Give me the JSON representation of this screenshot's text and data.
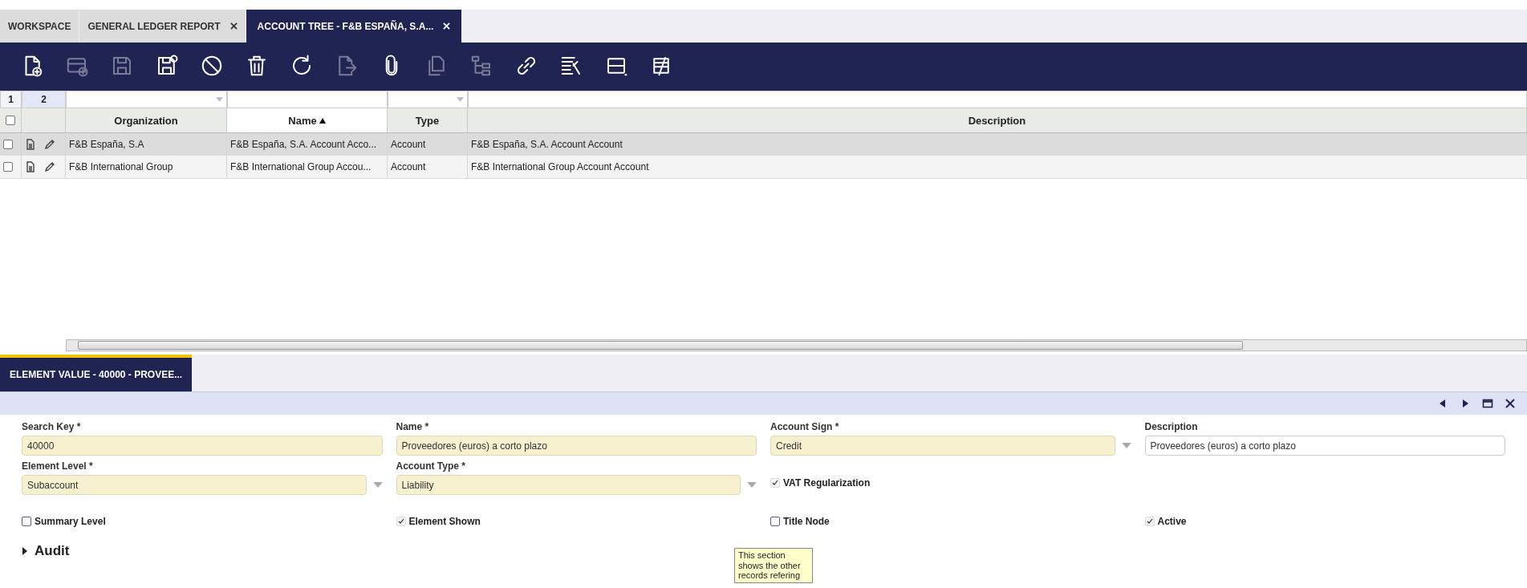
{
  "tabs": [
    {
      "label": "WORKSPACE",
      "closable": false,
      "selected": false
    },
    {
      "label": "GENERAL LEDGER REPORT",
      "closable": true,
      "selected": false
    },
    {
      "label": "ACCOUNT TREE - F&B ESPAÑA, S.A...",
      "closable": true,
      "selected": true
    }
  ],
  "toolbar": [
    {
      "disabled": false
    },
    {
      "disabled": true
    },
    {
      "disabled": true
    },
    {
      "disabled": false
    },
    {
      "disabled": false
    },
    {
      "disabled": false
    },
    {
      "disabled": false
    },
    {
      "disabled": true
    },
    {
      "disabled": false
    },
    {
      "disabled": true
    },
    {
      "disabled": true
    },
    {
      "disabled": false
    },
    {
      "disabled": false
    },
    {
      "disabled": false
    },
    {
      "disabled": false
    }
  ],
  "grid": {
    "counters": [
      "1",
      "2"
    ],
    "columns": [
      {
        "label": "Organization",
        "kind": "combo",
        "sorted": false
      },
      {
        "label": "Name",
        "kind": "text",
        "sorted": true
      },
      {
        "label": "Type",
        "kind": "combo",
        "sorted": false
      },
      {
        "label": "Description",
        "kind": "text",
        "sorted": false
      }
    ],
    "all_checked": false,
    "rows": [
      {
        "selected": true,
        "checked": false,
        "cells": [
          "F&B España, S.A",
          "F&B España, S.A. Account Acco...",
          "Account",
          "F&B España, S.A. Account Account"
        ]
      },
      {
        "selected": false,
        "checked": false,
        "cells": [
          "F&B International Group",
          "F&B International Group Accou...",
          "Account",
          "F&B International Group Account Account"
        ]
      }
    ]
  },
  "detail_tab": {
    "label": "ELEMENT VALUE - 40000 - PROVEE...",
    "selected": true
  },
  "form": {
    "rows": [
      [
        {
          "kind": "text",
          "label": "Search Key *",
          "value": "40000",
          "required": true
        },
        {
          "kind": "text",
          "label": "Name *",
          "value": "Proveedores (euros) a corto plazo",
          "required": true
        },
        {
          "kind": "combo",
          "label": "Account Sign *",
          "value": "Credit",
          "required": true
        },
        {
          "kind": "text",
          "label": "Description",
          "value": "Proveedores (euros) a corto plazo",
          "required": false
        }
      ],
      [
        {
          "kind": "combo",
          "label": "Element Level *",
          "value": "Subaccount",
          "required": true
        },
        {
          "kind": "combo",
          "label": "Account Type *",
          "value": "Liability",
          "required": true
        },
        {
          "kind": "checkbox",
          "label": "VAT Regularization",
          "checked": true
        }
      ],
      [
        {
          "kind": "checkbox",
          "label": "Summary Level",
          "checked": false
        },
        {
          "kind": "checkbox",
          "label": "Element Shown",
          "checked": true
        },
        {
          "kind": "checkbox",
          "label": "Title Node",
          "checked": false
        },
        {
          "kind": "checkbox",
          "label": "Active",
          "checked": true
        }
      ]
    ]
  },
  "sections": [
    {
      "label": "Audit",
      "expanded": false
    }
  ],
  "tooltip": {
    "text": "This section shows the other records refering"
  }
}
